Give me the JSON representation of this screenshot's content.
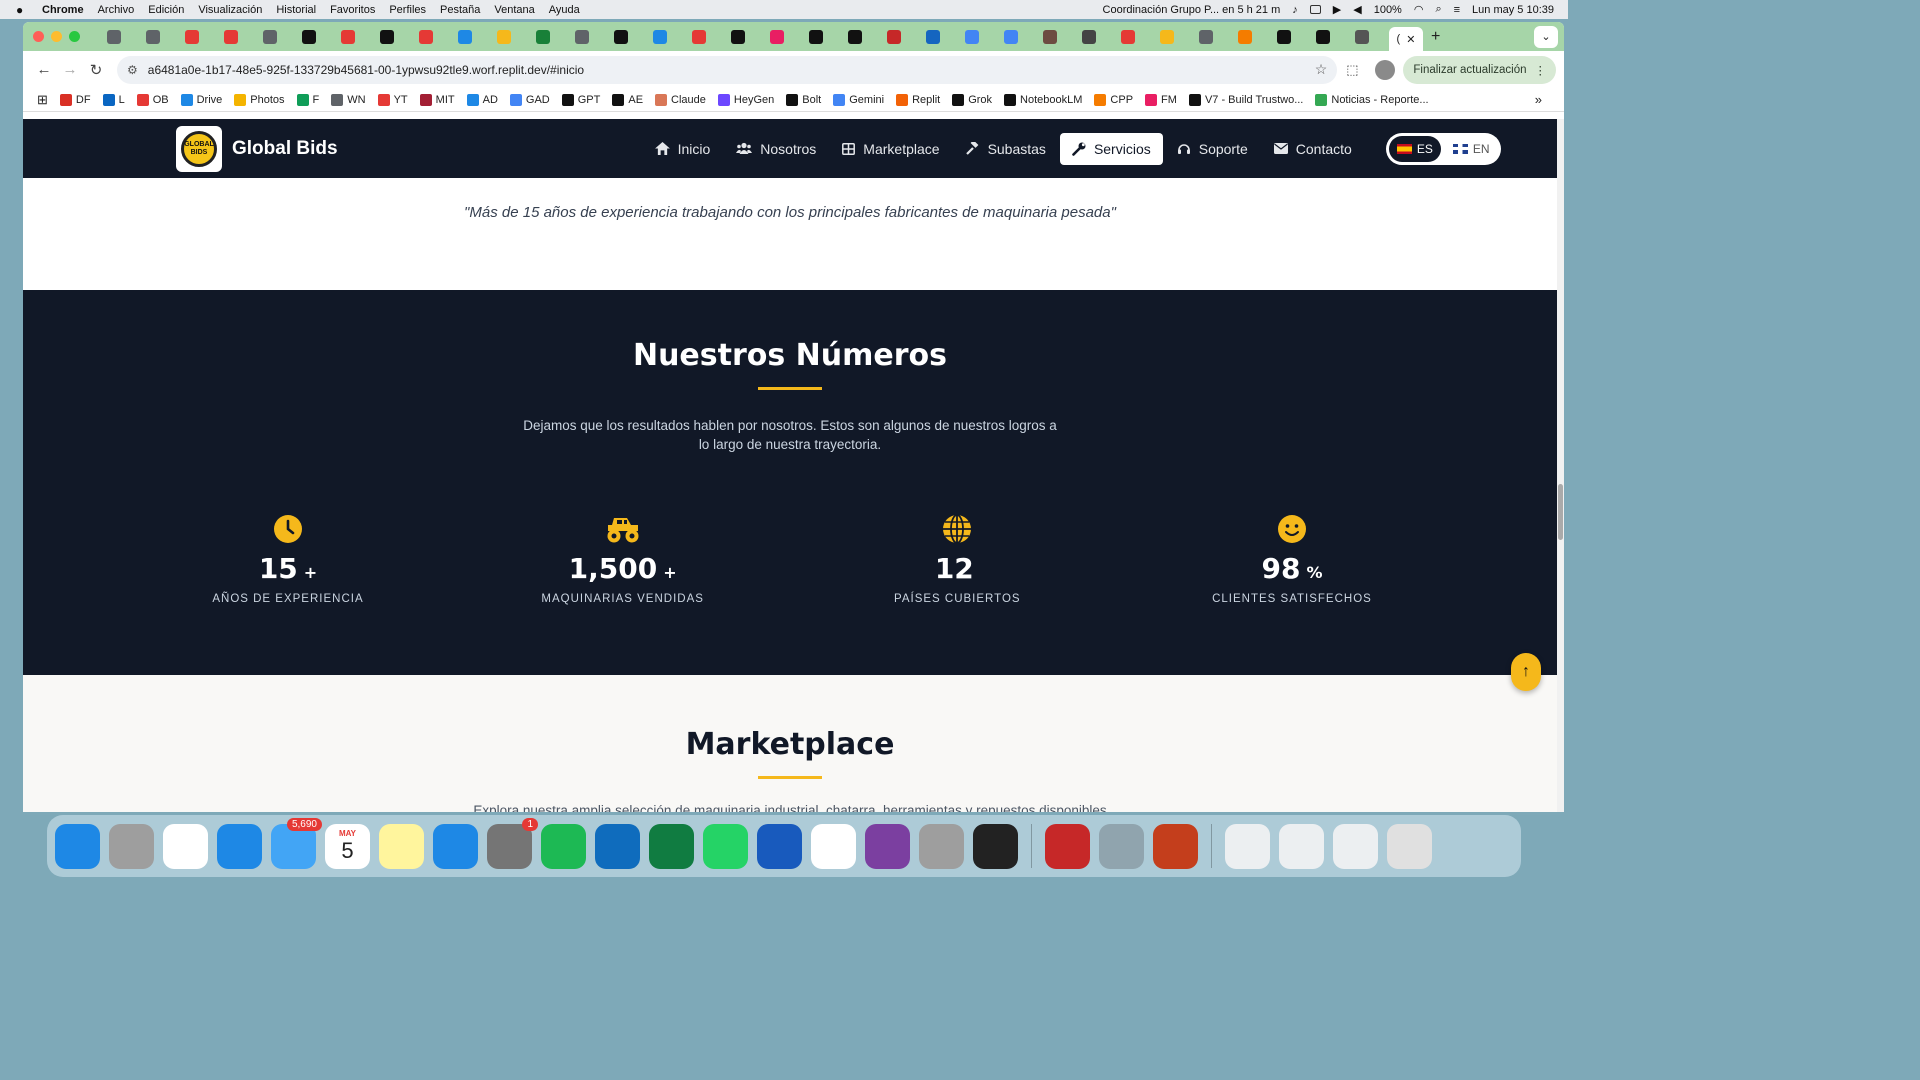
{
  "mac_menubar": {
    "app": "Chrome",
    "items": [
      "Archivo",
      "Edición",
      "Visualización",
      "Historial",
      "Favoritos",
      "Perfiles",
      "Pestaña",
      "Ventana",
      "Ayuda"
    ],
    "event": "Coordinación Grupo P... en 5 h 21 m",
    "battery": "100%",
    "clock": "Lun may 5  10:39"
  },
  "browser": {
    "tab_colors": [
      "#5f6368",
      "#5f6368",
      "#e53935",
      "#e53935",
      "#5f6368",
      "#111111",
      "#e53935",
      "#111111",
      "#e53935",
      "#1e88e5",
      "#f5b81b",
      "#188038",
      "#5f6368",
      "#111111",
      "#1e88e5",
      "#e53935",
      "#111111",
      "#e91e63",
      "#111111",
      "#111111",
      "#c62828",
      "#1565c0",
      "#4285f4",
      "#4285f4",
      "#6d4c41",
      "#444444",
      "#e53935",
      "#f5b81b",
      "#5f6368",
      "#f57c00",
      "#111111",
      "#111111",
      "#555555"
    ],
    "active_tab_glyph": "(",
    "url": "a6481a0e-1b17-48e5-925f-133729b45681-00-1ypwsu92tle9.worf.replit.dev/#inicio",
    "update_label": "Finalizar actualización",
    "bookmarks": [
      {
        "label": "DF",
        "color": "#d93025"
      },
      {
        "label": "L",
        "color": "#0a66c2"
      },
      {
        "label": "OB",
        "color": "#e53935"
      },
      {
        "label": "Drive",
        "color": "#1e88e5"
      },
      {
        "label": "Photos",
        "color": "#f4b400"
      },
      {
        "label": "F",
        "color": "#0f9d58"
      },
      {
        "label": "WN",
        "color": "#5f6368"
      },
      {
        "label": "YT",
        "color": "#e53935"
      },
      {
        "label": "MIT",
        "color": "#a31f34"
      },
      {
        "label": "AD",
        "color": "#1e88e5"
      },
      {
        "label": "GAD",
        "color": "#4285f4"
      },
      {
        "label": "GPT",
        "color": "#111111"
      },
      {
        "label": "AE",
        "color": "#111111"
      },
      {
        "label": "Claude",
        "color": "#d97757"
      },
      {
        "label": "HeyGen",
        "color": "#6c47ff"
      },
      {
        "label": "Bolt",
        "color": "#111111"
      },
      {
        "label": "Gemini",
        "color": "#4285f4"
      },
      {
        "label": "Replit",
        "color": "#f26207"
      },
      {
        "label": "Grok",
        "color": "#111111"
      },
      {
        "label": "NotebookLM",
        "color": "#111111"
      },
      {
        "label": "CPP",
        "color": "#f57c00"
      },
      {
        "label": "FM",
        "color": "#e91e63"
      },
      {
        "label": "V7 - Build Trustwo...",
        "color": "#111111"
      },
      {
        "label": "Noticias - Reporte...",
        "color": "#34a853"
      }
    ]
  },
  "site": {
    "brand": "Global Bids",
    "logo_text": "GLOBAL BIDS",
    "nav": [
      {
        "label": "Inicio",
        "icon": "home-icon",
        "active": false
      },
      {
        "label": "Nosotros",
        "icon": "users-icon",
        "active": false
      },
      {
        "label": "Marketplace",
        "icon": "grid-icon",
        "active": false
      },
      {
        "label": "Subastas",
        "icon": "gavel-icon",
        "active": false
      },
      {
        "label": "Servicios",
        "icon": "wrench-icon",
        "active": true
      },
      {
        "label": "Soporte",
        "icon": "headset-icon",
        "active": false
      },
      {
        "label": "Contacto",
        "icon": "envelope-icon",
        "active": false
      }
    ],
    "languages": [
      {
        "code": "ES",
        "active": true
      },
      {
        "code": "EN",
        "active": false
      }
    ],
    "quote": "\"Más de 15 años de experiencia trabajando con los principales fabricantes de maquinaria pesada\"",
    "numbers": {
      "title": "Nuestros Números",
      "description": "Dejamos que los resultados hablen por nosotros. Estos son algunos de nuestros logros a lo largo de nuestra trayectoria.",
      "accent": "#f5b81b",
      "stats": [
        {
          "icon": "clock-icon",
          "value": "15",
          "suffix": "+",
          "label": "AÑOS DE EXPERIENCIA"
        },
        {
          "icon": "monster-truck-icon",
          "value": "1,500",
          "suffix": "+",
          "label": "MAQUINARIAS VENDIDAS"
        },
        {
          "icon": "globe-icon",
          "value": "12",
          "suffix": "",
          "label": "PAÍSES CUBIERTOS"
        },
        {
          "icon": "smile-icon",
          "value": "98",
          "suffix": "%",
          "label": "CLIENTES SATISFECHOS"
        }
      ]
    },
    "marketplace": {
      "title": "Marketplace",
      "description": "Explora nuestra amplia selección de maquinaria industrial, chatarra, herramientas y repuestos disponibles"
    },
    "back_to_top_icon": "arrow-up-icon"
  },
  "dock": {
    "apps": [
      {
        "name": "Finder",
        "color": "#1e88e5"
      },
      {
        "name": "Launchpad",
        "color": "#9e9e9e"
      },
      {
        "name": "Chrome",
        "color": "#ffffff"
      },
      {
        "name": "Safari",
        "color": "#1e88e5"
      },
      {
        "name": "Mail",
        "color": "#42a5f5",
        "badge": "5,690"
      },
      {
        "name": "Calendar",
        "color": "#ffffff",
        "month": "MAY",
        "day": "5"
      },
      {
        "name": "Notes",
        "color": "#fff59d"
      },
      {
        "name": "Keynote",
        "color": "#1e88e5"
      },
      {
        "name": "System Settings",
        "color": "#757575",
        "badge": "1"
      },
      {
        "name": "Spotify",
        "color": "#1db954"
      },
      {
        "name": "Outlook",
        "color": "#0f6cbd"
      },
      {
        "name": "Excel",
        "color": "#107c41"
      },
      {
        "name": "WhatsApp",
        "color": "#25d366"
      },
      {
        "name": "Word",
        "color": "#185abd"
      },
      {
        "name": "Calendar 5",
        "color": "#ffffff"
      },
      {
        "name": "Circle",
        "color": "#7b3fa0"
      },
      {
        "name": "Pencil",
        "color": "#9e9e9e"
      },
      {
        "name": "Figma-like",
        "color": "#222222"
      },
      {
        "name": "Acrobat",
        "color": "#c62828"
      },
      {
        "name": "Preview",
        "color": "#90a4ae"
      },
      {
        "name": "PowerPoint",
        "color": "#c43e1c"
      },
      {
        "name": "Screenshots",
        "color": "#eceff1"
      },
      {
        "name": "Documents",
        "color": "#eceff1"
      },
      {
        "name": "PDF",
        "color": "#eceff1"
      },
      {
        "name": "Trash",
        "color": "#e0e0e0"
      }
    ]
  }
}
